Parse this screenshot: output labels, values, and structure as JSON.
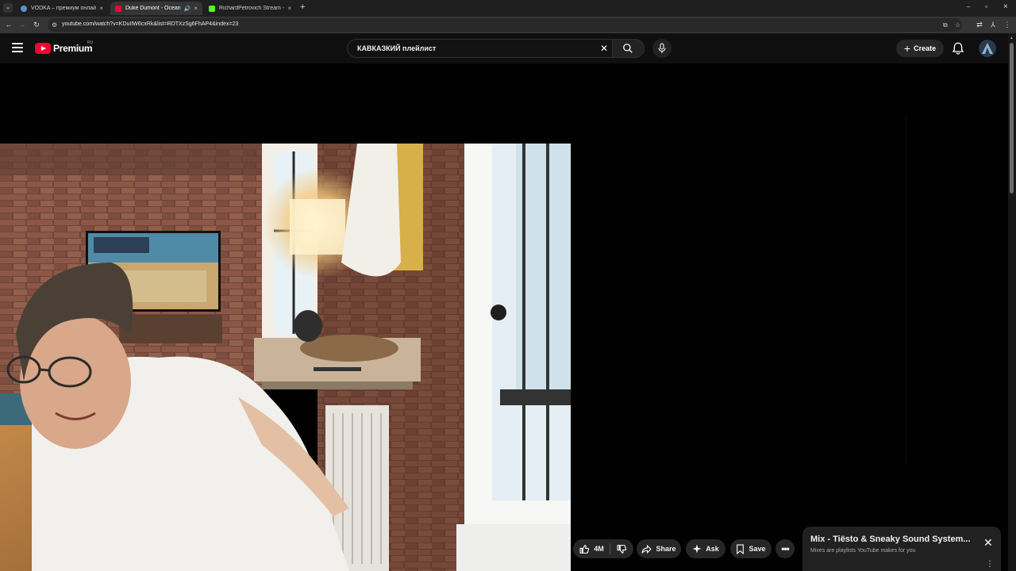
{
  "browser": {
    "tabs": [
      {
        "title": "VODKA – премиум онлайн-ка",
        "favicon_color": "#5a8fd0",
        "active": false
      },
      {
        "title": "Duke Dumont - Ocean Dri",
        "favicon_color": "#ff0033",
        "active": true
      },
      {
        "title": "RichardPetrovich Stream - Wat",
        "favicon_color": "#53fc18",
        "active": false
      }
    ],
    "tab_close_glyph": "×",
    "new_tab_glyph": "+",
    "url": "youtube.com/watch?v=KDuIIW6cxRk&list=RDTXzSg6FhAP4&index=23",
    "window_controls": {
      "minimize": "–",
      "maximize": "▫",
      "close": "×"
    }
  },
  "header": {
    "logo_text": "Premium",
    "logo_region": "RU",
    "search_query": "КАВКАЗКИЙ плейлист",
    "create_label": "Create"
  },
  "actions": {
    "like_count": "4M",
    "share_label": "Share",
    "ask_label": "Ask",
    "save_label": "Save"
  },
  "mix": {
    "title": "Mix - Tiësto & Sneaky Sound System...",
    "subtitle": "Mixes are playlists YouTube makes for you"
  },
  "colors": {
    "brand_red": "#ff0033",
    "page_bg": "#0f0f0f",
    "chip_bg": "#272727"
  }
}
